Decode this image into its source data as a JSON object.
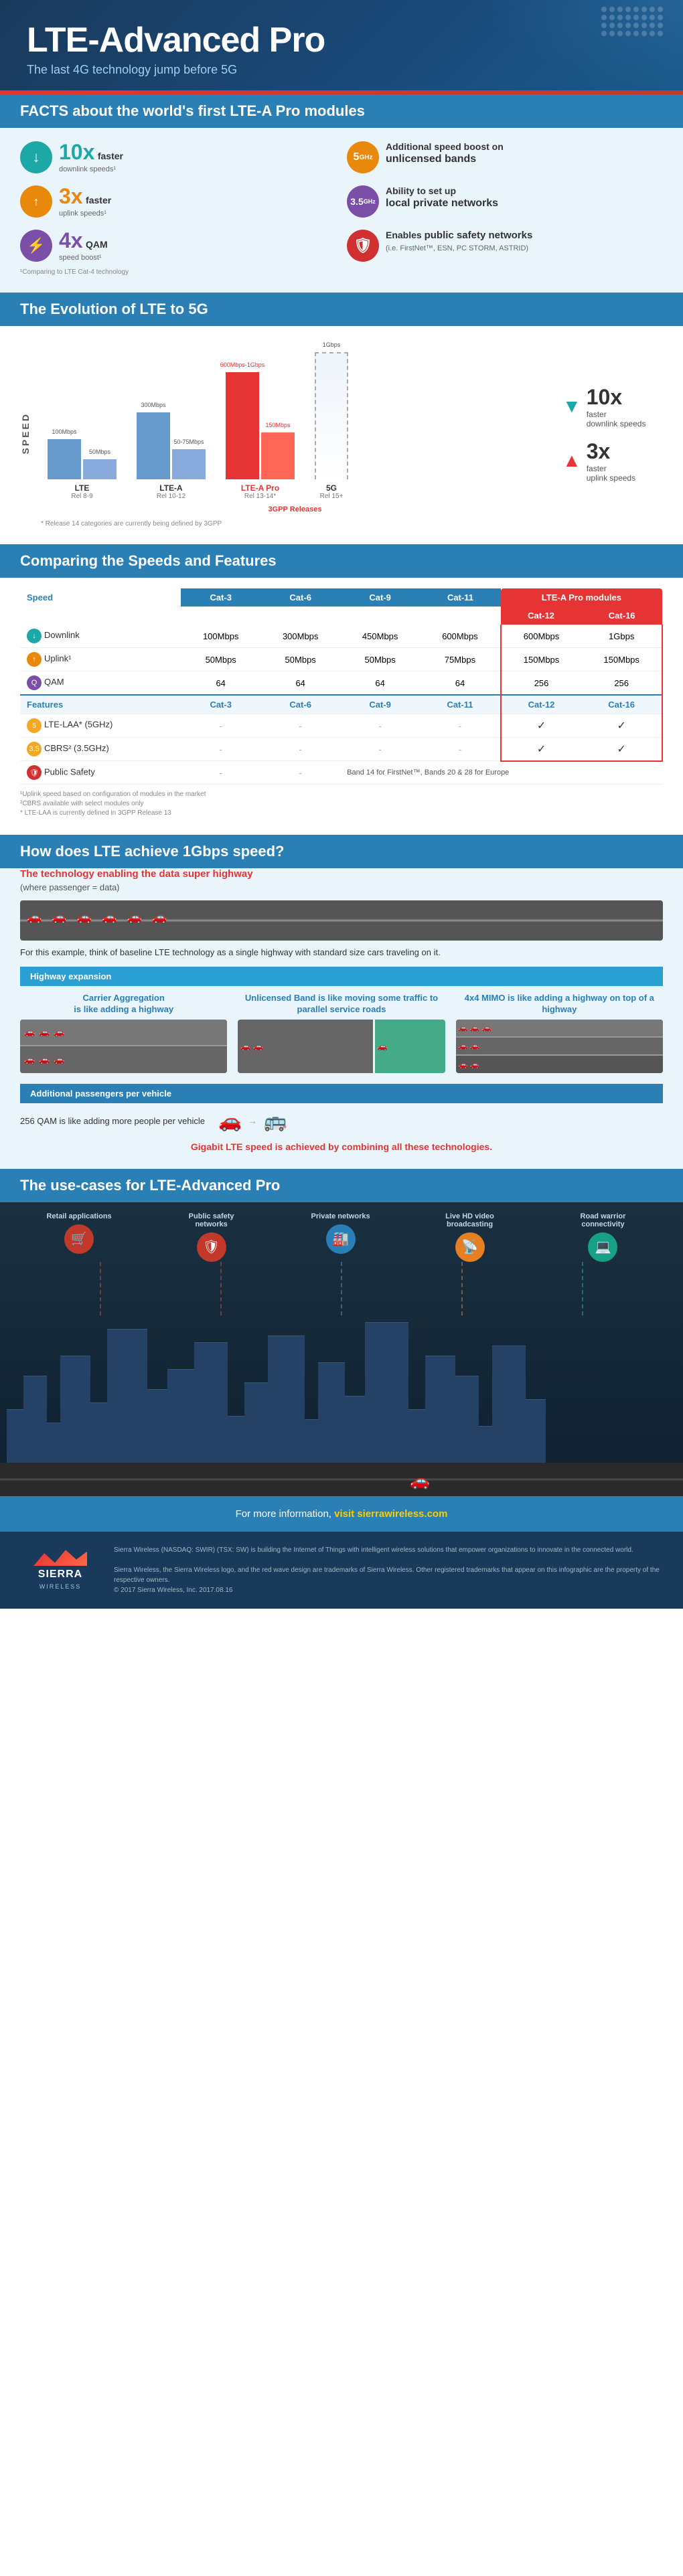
{
  "header": {
    "title": "LTE-Advanced Pro",
    "subtitle": "The last 4G technology jump before 5G"
  },
  "facts_section": {
    "heading": "FACTS about the world's first LTE-A Pro modules",
    "items": [
      {
        "multiplier": "10x",
        "label": "faster",
        "sublabel": "downlink speeds¹",
        "icon_type": "teal",
        "icon_symbol": "↓"
      },
      {
        "ghz": "5",
        "unit": "GHz",
        "label": "Additional speed boost on",
        "highlight": "unlicensed bands",
        "icon_type": "orange"
      },
      {
        "multiplier": "3x",
        "label": "faster",
        "sublabel": "uplink speeds¹",
        "icon_type": "orange",
        "icon_symbol": "↑"
      },
      {
        "ghz": "3.5",
        "unit": "GHz",
        "label": "Ability to set up",
        "highlight": "local private networks",
        "icon_type": "purple"
      },
      {
        "multiplier": "4x",
        "label": "QAM",
        "sublabel": "speed boost¹",
        "icon_type": "purple",
        "icon_symbol": "⚡"
      },
      {
        "label": "Enables",
        "highlight": "public safety networks",
        "sublabel": "(i.e. FirstNet™, ESN, PC STORM, ASTRID)",
        "icon_type": "red",
        "icon_symbol": "🛡"
      }
    ],
    "footnote": "¹Comparing to LTE Cat-4 technology"
  },
  "evolution_section": {
    "heading": "The Evolution of LTE to 5G",
    "chart": {
      "groups": [
        {
          "label": "LTE",
          "rel": "Rel 8-9",
          "bars": [
            {
              "label": "100Mbps",
              "height": 60,
              "color": "blue"
            },
            {
              "label": "50Mbps",
              "height": 30,
              "color": "blue"
            }
          ]
        },
        {
          "label": "LTE-A",
          "rel": "Rel 10-12",
          "bars": [
            {
              "label": "300Mbps",
              "height": 100,
              "color": "blue"
            },
            {
              "label": "50-75Mbps",
              "height": 45,
              "color": "blue"
            }
          ]
        },
        {
          "label": "LTE-A Pro",
          "rel": "Rel 13-14*",
          "highlight": true,
          "bars": [
            {
              "label": "600Mbps-1Gbps",
              "height": 160,
              "color": "red"
            },
            {
              "label": "150Mbps",
              "height": 70,
              "color": "red"
            }
          ]
        },
        {
          "label": "5G",
          "rel": "Rel 15+",
          "bars": [
            {
              "label": "",
              "height": 190,
              "color": "gray_dashed"
            }
          ]
        }
      ],
      "right_labels": [
        {
          "arrow": "▼",
          "multiplier": "10x",
          "text": "faster downlink speeds",
          "color": "teal"
        },
        {
          "arrow": "▲",
          "multiplier": "3x",
          "text": "faster uplink speeds",
          "color": "red"
        }
      ],
      "release_label": "3GPP Releases",
      "note": "* Release 14 categories are currently being defined by 3GPP"
    }
  },
  "speeds_section": {
    "heading": "Comparing the Speeds and Features",
    "lta_pro_label": "LTE-A Pro modules",
    "columns": [
      "Speed",
      "Cat-3",
      "Cat-6",
      "Cat-9",
      "Cat-11",
      "Cat-12",
      "Cat-16"
    ],
    "rows": [
      {
        "icon": "dl",
        "label": "Downlink",
        "values": [
          "100Mbps",
          "300Mbps",
          "450Mbps",
          "600Mbps",
          "600Mbps",
          "1Gbps"
        ]
      },
      {
        "icon": "ul",
        "label": "Uplink¹",
        "values": [
          "50Mbps",
          "50Mbps",
          "50Mbps",
          "75Mbps",
          "150Mbps",
          "150Mbps"
        ]
      },
      {
        "icon": "qam",
        "label": "QAM",
        "values": [
          "64",
          "64",
          "64",
          "64",
          "256",
          "256"
        ]
      }
    ],
    "feature_columns": [
      "Features",
      "Cat-3",
      "Cat-6",
      "Cat-9",
      "Cat-11",
      "Cat-12",
      "Cat-16"
    ],
    "feature_rows": [
      {
        "icon": "laa",
        "label": "LTE-LAA* (5GHz)",
        "values": [
          "-",
          "-",
          "-",
          "-",
          "✓",
          "✓"
        ]
      },
      {
        "icon": "cbrs",
        "label": "CBRS² (3.5GHz)",
        "values": [
          "-",
          "-",
          "-",
          "-",
          "✓",
          "✓"
        ]
      },
      {
        "icon": "ps",
        "label": "Public Safety",
        "values": [
          "-",
          "-",
          "Band 14 for FirstNet™, Bands 20 & 28 for Europe",
          "",
          "",
          ""
        ]
      }
    ],
    "notes": [
      "¹Uplink speed based on configuration of modules in the market",
      "²CBRS available with select modules only",
      "* LTE-LAA is currently defined in 3GPP Release 13"
    ]
  },
  "gbps_section": {
    "heading": "How does LTE achieve 1Gbps speed?",
    "subtitle": "The technology enabling the data super highway",
    "subtitle2": "(where passenger = data)",
    "baseline_text": "For this example, think of baseline LTE technology as a single highway with standard size cars traveling on it.",
    "highway_label": "Highway expansion",
    "cards": [
      {
        "title": "Carrier Aggregation is like adding a highway",
        "desc": ""
      },
      {
        "title": "Unlicensed Band is like moving some traffic to parallel service roads",
        "desc": ""
      },
      {
        "title": "4x4 MIMO is like adding a highway on top of a highway",
        "desc": ""
      }
    ],
    "passengers_label": "Additional passengers per vehicle",
    "qam_text": "256 QAM is like adding more people per vehicle",
    "gigabit_label": "Gigabit LTE speed is achieved by combining all these technologies."
  },
  "usecases_section": {
    "heading": "The use-cases for LTE-Advanced Pro",
    "items": [
      {
        "label": "Retail applications",
        "icon": "🛒",
        "color": "uc-red"
      },
      {
        "label": "Public safety networks",
        "icon": "🛡",
        "color": "uc-red"
      },
      {
        "label": "Private networks",
        "icon": "🏭",
        "color": "uc-blue"
      },
      {
        "label": "Live HD video broadcasting",
        "icon": "📡",
        "color": "uc-orange"
      },
      {
        "label": "Road warrior connectivity",
        "icon": "💻",
        "color": "uc-teal"
      }
    ]
  },
  "footer": {
    "info_text": "For more information,",
    "link_text": "visit sierrawireless.com",
    "logo_top": "SIERRA",
    "logo_bottom": "WIRELESS",
    "legal": "Sierra Wireless (NASDAQ: SWIR) (TSX: SW) is building the Internet of Things with intelligent wireless solutions that empower organizations to innovate in the connected world.\n\nSierra Wireless, the Sierra Wireless logo, and the red wave design are trademarks of Sierra Wireless.\nOther registered trademarks that appear on this infographic are the property of the respective owners.\n© 2017 Sierra Wireless, Inc. 2017.08.16"
  }
}
